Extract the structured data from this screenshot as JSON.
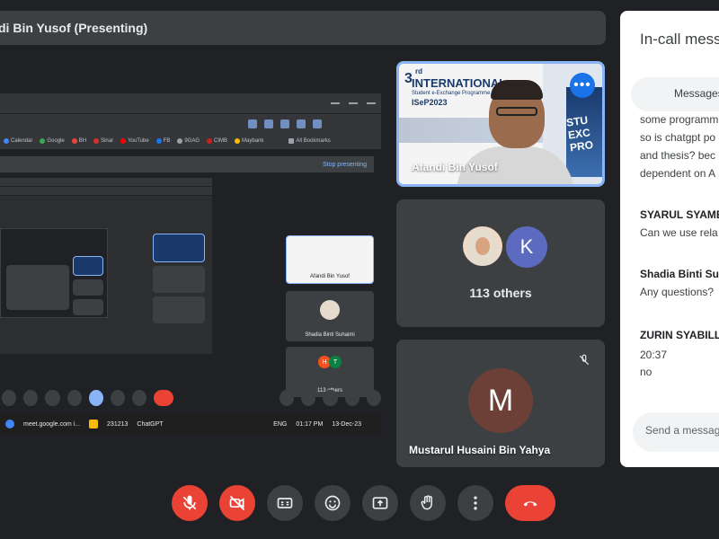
{
  "presenter_bar": {
    "text": "di Bin Yusof (Presenting)"
  },
  "shared_screen": {
    "bookmarks": [
      "Calendar",
      "Google",
      "BH",
      "Sinar",
      "YouTube",
      "FB",
      "9GAG",
      "CIMB",
      "Maybank",
      "All Bookmarks"
    ],
    "stop_presenting": "Stop presenting",
    "nested_tiles": {
      "speaker": "Afandi Bin Yusof",
      "shadia": "Shadia Binti Suhaimi",
      "others": "113 others"
    },
    "taskbar_items": [
      "meet.google.com i...",
      "231213",
      "ChatGPT"
    ],
    "clock": {
      "lang": "ENG",
      "time": "01:17 PM",
      "date": "13-Dec-23"
    }
  },
  "tiles": {
    "speaker": {
      "name": "Afandi Bin Yusof",
      "banner_num": "3",
      "banner_suffix": "rd",
      "banner_title": "INTERNATIONAL",
      "banner_sub": "Student e-Exchange Programme",
      "banner_code": "ISeP2023",
      "pillar_text": "STU\nEXC\nPRO"
    },
    "others": {
      "avatar_letter": "K",
      "label": "113 others"
    },
    "mustarul": {
      "avatar_letter": "M",
      "name": "Mustarul Husaini Bin Yahya"
    }
  },
  "chat": {
    "title": "In-call messages",
    "tab": "Messages",
    "messages": [
      {
        "lines": [
          "some programm",
          "so is chatgpt po",
          "and thesis? bec",
          "dependent on A"
        ]
      },
      {
        "sender": "SYARUL SYAMEI",
        "text": "Can we use rela"
      },
      {
        "sender": "Shadia Binti Suh",
        "text": "Any questions?"
      },
      {
        "sender": "ZURIN SYABILL",
        "time": "20:37",
        "text": "no"
      }
    ],
    "input_placeholder": "Send a message"
  },
  "colors": {
    "bg": "#202124",
    "tile": "#3c4043",
    "accent": "#8ab4f8",
    "danger": "#ea4335",
    "k_avatar": "#5c6bc0",
    "m_avatar": "#6d4037"
  },
  "controls": [
    "mic-off-icon",
    "camera-off-icon",
    "captions-icon",
    "emoji-icon",
    "present-icon",
    "raise-hand-icon",
    "more-vert-icon",
    "end-call-icon"
  ]
}
